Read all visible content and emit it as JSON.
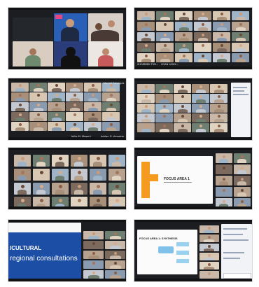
{
  "grid": {
    "shots": [
      {
        "id": "shot-1"
      },
      {
        "id": "shot-2",
        "names": [
          "SHOIRBEK TUR...",
          "VOAN LOWL..."
        ]
      },
      {
        "id": "shot-3",
        "names": [
          "Mariell Fabregas",
          "Jellie M. Masonl",
          "Adrian G. Amarelo"
        ]
      },
      {
        "id": "shot-4"
      },
      {
        "id": "shot-5"
      },
      {
        "id": "shot-6",
        "slide_title": "FOCUS AREA 1"
      },
      {
        "id": "shot-7",
        "slide_line1": "ICULTURAL",
        "slide_line2": "regional consultations"
      },
      {
        "id": "shot-8",
        "slide_title": "FOCUS AREA 1: SYNTHESIS"
      }
    ]
  },
  "colors": {
    "zoom_bg": "#1b1d21",
    "slide_blue": "#1c4ea6",
    "slide_orange": "#f39a1f",
    "accent_pink": "#e8457a"
  }
}
